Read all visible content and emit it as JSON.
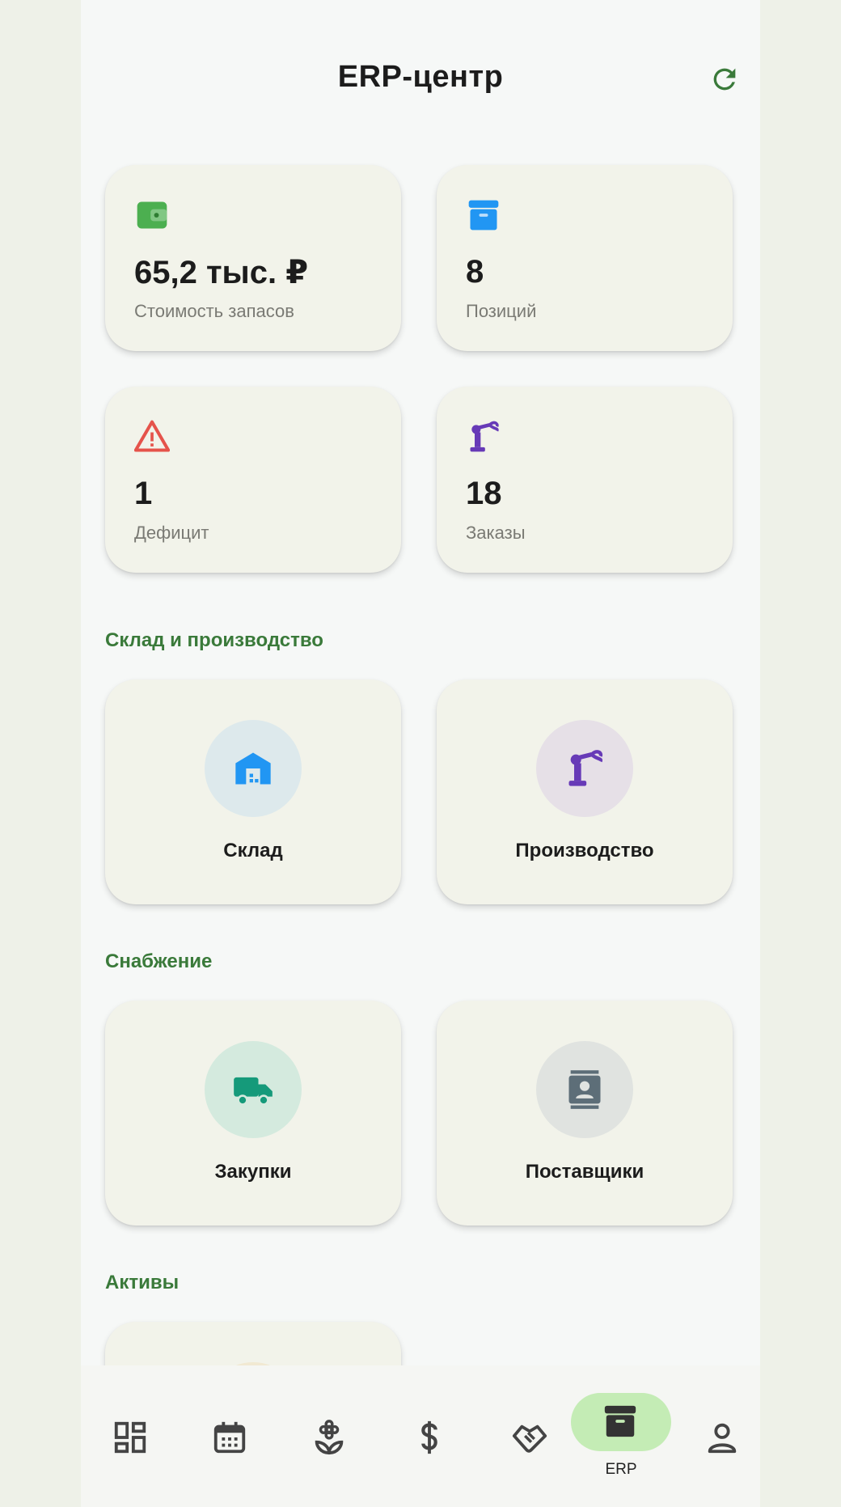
{
  "header": {
    "title": "ERP-центр"
  },
  "stats": [
    {
      "value": "65,2 тыс. ₽",
      "label": "Стоимость запасов",
      "icon": "wallet-icon",
      "color": "#4caf50"
    },
    {
      "value": "8",
      "label": "Позиций",
      "icon": "archive-icon",
      "color": "#2196f3"
    },
    {
      "value": "1",
      "label": "Дефицит",
      "icon": "warning-icon",
      "color": "#e5534b"
    },
    {
      "value": "18",
      "label": "Заказы",
      "icon": "robot-arm-icon",
      "color": "#673ab7"
    }
  ],
  "sections": [
    {
      "title": "Склад и производство",
      "tiles": [
        {
          "label": "Склад",
          "icon": "warehouse-icon",
          "color": "#2196f3",
          "bg": "#dde9ec"
        },
        {
          "label": "Производство",
          "icon": "robot-arm-icon",
          "color": "#673ab7",
          "bg": "#e6e0e7"
        }
      ]
    },
    {
      "title": "Снабжение",
      "tiles": [
        {
          "label": "Закупки",
          "icon": "truck-icon",
          "color": "#159a7a",
          "bg": "#d4eade"
        },
        {
          "label": "Поставщики",
          "icon": "contacts-icon",
          "color": "#5d6e78",
          "bg": "#e0e3e0"
        }
      ]
    },
    {
      "title": "Активы",
      "tiles": []
    }
  ],
  "nav": {
    "items": [
      "dashboard-icon",
      "calendar-icon",
      "flower-icon",
      "dollar-icon",
      "handshake-icon",
      "archive-icon",
      "person-icon"
    ],
    "active_label": "ERP",
    "accent": "#c4ecb5"
  },
  "colors": {
    "section_title": "#3a7a3a",
    "refresh": "#3a7a3a"
  }
}
